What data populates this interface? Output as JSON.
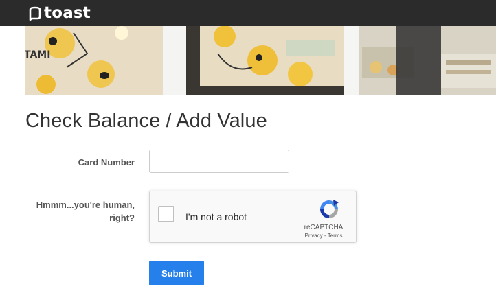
{
  "header": {
    "brand_text": "toast",
    "brand_icon": "toast-logo-icon",
    "background_color": "#2b2b2b"
  },
  "banner": {
    "icon": "restaurant-photo-banner"
  },
  "page": {
    "title": "Check Balance / Add Value"
  },
  "form": {
    "card_number_label": "Card Number",
    "card_number_value": "",
    "captcha_label_line1": "Hmmm...you're human,",
    "captcha_label_line2": "right?",
    "submit_label": "Submit",
    "accent_color": "#2680eb"
  },
  "recaptcha": {
    "checkbox_label": "I'm not a robot",
    "brand": "reCAPTCHA",
    "privacy_link": "Privacy",
    "separator": " - ",
    "terms_link": "Terms",
    "icon": "recaptcha-logo-icon"
  }
}
